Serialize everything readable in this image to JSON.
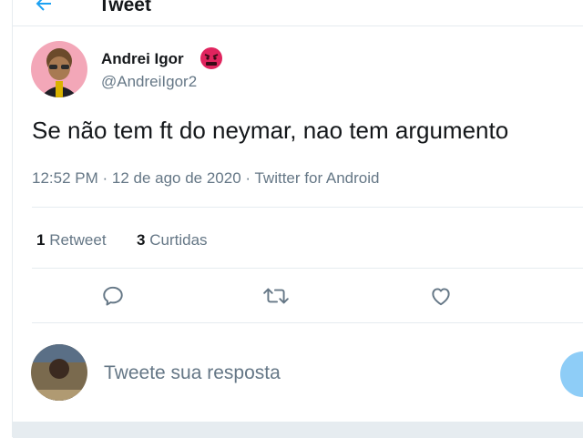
{
  "header": {
    "title": "Tweet"
  },
  "tweet": {
    "author_name": "Andrei Igor",
    "handle": "@AndreiIgor2",
    "text": "Se não tem ft do neymar, nao tem argumento",
    "meta": "12:52 PM · 12 de ago de 2020 · Twitter for Android"
  },
  "stats": {
    "retweets_count": "1",
    "retweets_label": "Retweet",
    "likes_count": "3",
    "likes_label": "Curtidas"
  },
  "icons": {
    "back": "back-arrow-icon",
    "reply": "reply-icon",
    "retweet": "retweet-icon",
    "like": "heart-icon"
  },
  "reply_box": {
    "placeholder": "Tweete sua resposta"
  },
  "colors": {
    "accent": "#1da1f2",
    "muted": "#657786",
    "divider": "#e6ecf0"
  }
}
